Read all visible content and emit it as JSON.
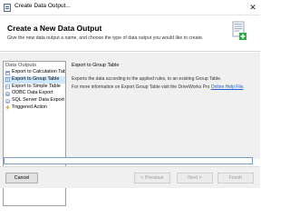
{
  "window": {
    "title": "Create Data Output...",
    "close_glyph": "✕"
  },
  "header": {
    "title": "Create a New Data Output",
    "description": "Give the new data output a name, and choose the type of data output you would like to create.",
    "icon": "wizard-data-output-icon"
  },
  "tree": {
    "root_label": "Data Outputs",
    "items": [
      {
        "label": "Export to Calculation Tab",
        "icon": "calculation-icon",
        "selected": false
      },
      {
        "label": "Export to Group Table",
        "icon": "group-table-icon",
        "selected": true
      },
      {
        "label": "Export to Simple Table",
        "icon": "simple-table-icon",
        "selected": false
      },
      {
        "label": "ODBC Data Export",
        "icon": "odbc-icon",
        "selected": false
      },
      {
        "label": "SQL Server Data Export",
        "icon": "sql-server-icon",
        "selected": false
      },
      {
        "label": "Triggered Action",
        "icon": "triggered-action-icon",
        "selected": false
      }
    ]
  },
  "detail": {
    "title": "Export to Group Table",
    "description": "Exports the data according to the applied rules, to an existing Group Table.",
    "more_prefix": "For more information on Export Group Table visit the DriveWorks Pro ",
    "more_link": "Online Help File",
    "more_suffix": "."
  },
  "footer": {
    "cancel_label": "Cancel",
    "previous_label": "< Previous",
    "next_label": "Next >",
    "finish_label": "Finish"
  },
  "colors": {
    "selection": "#cde8ff",
    "link": "#1a5fd6",
    "accent_green": "#2fa84a"
  }
}
